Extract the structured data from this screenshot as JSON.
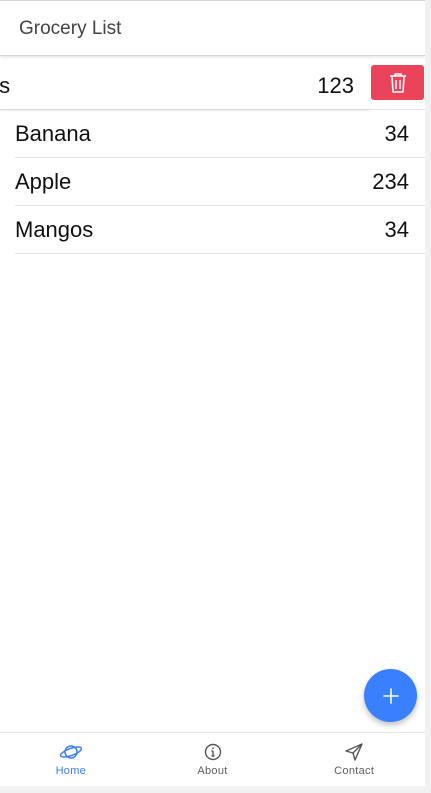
{
  "header": {
    "title": "Grocery List"
  },
  "items": [
    {
      "name": "ts",
      "qty": "123"
    },
    {
      "name": "Banana",
      "qty": "34"
    },
    {
      "name": "Apple",
      "qty": "234"
    },
    {
      "name": "Mangos",
      "qty": "34"
    }
  ],
  "delete_icon": "trash-icon",
  "fab_icon": "add-icon",
  "tabs": [
    {
      "label": "Home",
      "icon": "planet-icon",
      "active": true
    },
    {
      "label": "About",
      "icon": "info-icon",
      "active": false
    },
    {
      "label": "Contact",
      "icon": "send-icon",
      "active": false
    }
  ],
  "colors": {
    "primary": "#3880ff",
    "danger": "#eb445a"
  }
}
